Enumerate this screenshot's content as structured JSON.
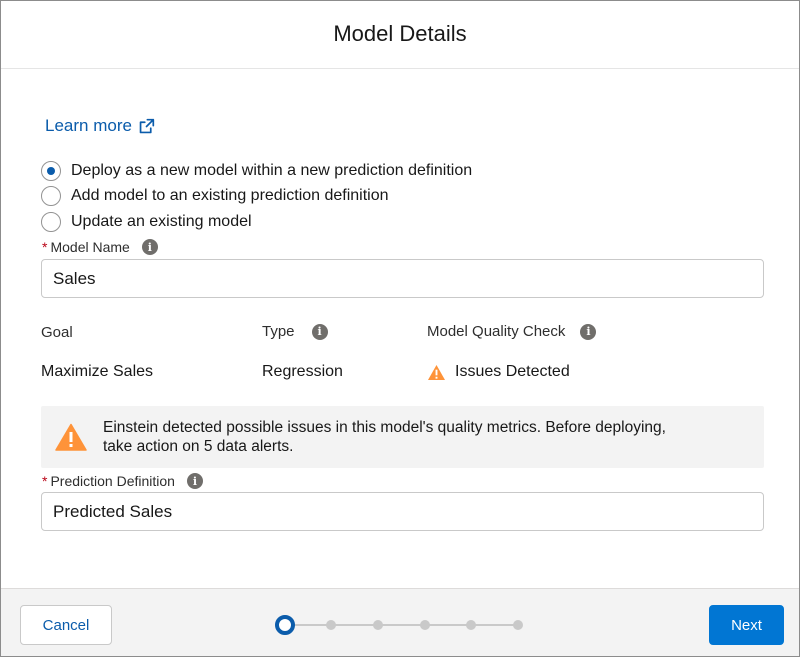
{
  "modal": {
    "title": "Model Details"
  },
  "learn_more": {
    "label": "Learn more",
    "icon": "external-link-icon"
  },
  "deploy_options": [
    {
      "label": "Deploy as a new model within a new prediction definition",
      "selected": true
    },
    {
      "label": "Add model to an existing prediction definition",
      "selected": false
    },
    {
      "label": "Update an existing model",
      "selected": false
    }
  ],
  "model_name": {
    "label": "Model Name",
    "required_marker": "*",
    "value": "Sales"
  },
  "details": {
    "goal_label": "Goal",
    "goal_value": "Maximize Sales",
    "type_label": "Type",
    "type_value": "Regression",
    "quality_label": "Model Quality Check",
    "quality_value": "Issues Detected"
  },
  "alert": {
    "line1": "Einstein detected possible issues in this model's quality metrics. Before deploying,",
    "line2": "take action on 5 data alerts."
  },
  "prediction_definition": {
    "label": "Prediction Definition",
    "required_marker": "*",
    "value": "Predicted Sales"
  },
  "footer": {
    "cancel_label": "Cancel",
    "next_label": "Next",
    "progress_steps": 6,
    "current_step": 1
  },
  "colors": {
    "brand": "#0176d3",
    "link": "#0b5cab",
    "warning": "#fe9339",
    "required": "#ba0517"
  }
}
